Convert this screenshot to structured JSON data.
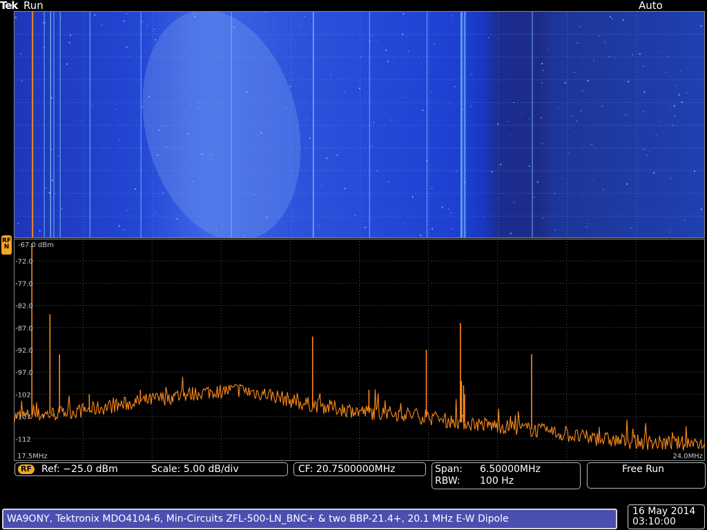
{
  "header": {
    "logo": "Tek",
    "status": "Run",
    "trigger_mode": "Auto"
  },
  "rf_marker": {
    "top": "RF",
    "bottom": "N"
  },
  "spectrum": {
    "ref_top_label": "-67.0 dBm",
    "y_tick_labels": [
      "-72.0",
      "-77.0",
      "-82.0",
      "-87.0",
      "-92.0",
      "-97.0",
      "-102",
      "-107",
      "-112"
    ],
    "start_freq_label": "17.5MHz",
    "stop_freq_label": "24.0MHz"
  },
  "chart_data": {
    "type": "line",
    "title": "",
    "xlabel": "",
    "ylabel": "",
    "xlim": [
      17.5,
      24.0
    ],
    "ylim": [
      -117,
      -67
    ],
    "x_unit": "MHz",
    "y_unit": "dBm",
    "noise_floor_profile": {
      "x": [
        17.5,
        17.8,
        18.2,
        18.6,
        19.0,
        19.3,
        19.6,
        19.9,
        20.2,
        20.5,
        20.8,
        21.2,
        21.6,
        22.0,
        22.4,
        22.8,
        23.2,
        23.6,
        24.0
      ],
      "y": [
        -107,
        -106.5,
        -105.5,
        -104,
        -102.5,
        -101.5,
        -101,
        -102,
        -104,
        -105,
        -106,
        -106.5,
        -108,
        -109,
        -110,
        -111.5,
        -112.5,
        -113,
        -113
      ]
    },
    "spurs": {
      "x": [
        17.67,
        17.78,
        17.84,
        17.87,
        17.93,
        18.21,
        18.69,
        19.54,
        20.31,
        20.84,
        21.38,
        21.7,
        21.71,
        21.73,
        21.74,
        22.37
      ],
      "y": [
        -68,
        -107,
        -84,
        -107,
        -93,
        -102,
        -101,
        -101,
        -89,
        -101,
        -92,
        -86,
        -99,
        -100,
        -102,
        -93
      ]
    }
  },
  "controls": {
    "ref_badge": "RF",
    "ref_text": "Ref: −25.0 dBm",
    "scale_text": "Scale: 5.00 dB/div",
    "cf_text": "CF: 20.7500000MHz",
    "span_label": "Span:",
    "span_value": "6.50000MHz",
    "rbw_label": "RBW:",
    "rbw_value": "100 Hz",
    "free_run": "Free Run"
  },
  "footer": {
    "info": "WA9ONY, Tektronix MDO4104-6, Min-Circuits ZFL-500-LN_BNC+ & two BBP-21.4+, 20.1 MHz E-W Dipole",
    "date": "16 May 2014",
    "time": "03:10:00"
  },
  "colors": {
    "trace": "#ff8c1a",
    "marker": "#f5a623",
    "banner": "#4b4fb0"
  }
}
